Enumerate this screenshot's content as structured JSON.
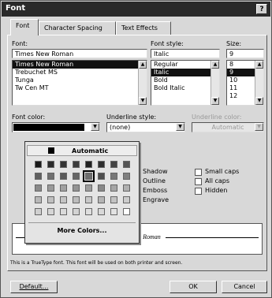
{
  "window": {
    "title": "Font",
    "help": "?"
  },
  "tabs": [
    {
      "label": "Font"
    },
    {
      "label": "Character Spacing"
    },
    {
      "label": "Text Effects"
    }
  ],
  "font": {
    "label": "Font:",
    "value": "Times New Roman",
    "items": [
      "Times New Roman",
      "Trebuchet MS",
      "Tunga",
      "Tw Cen MT"
    ],
    "selected_index": 0
  },
  "style": {
    "label": "Font style:",
    "value": "Italic",
    "items": [
      "Regular",
      "Italic",
      "Bold",
      "Bold Italic"
    ],
    "selected_index": 1
  },
  "size": {
    "label": "Size:",
    "value": "9",
    "items": [
      "8",
      "9",
      "10",
      "11",
      "12"
    ],
    "selected_index": 1
  },
  "font_color": {
    "label": "Font color:"
  },
  "underline_style": {
    "label": "Underline style:",
    "value": "(none)"
  },
  "underline_color": {
    "label": "Underline color:",
    "value": "Automatic"
  },
  "color_popup": {
    "automatic": "Automatic",
    "more": "More Colors...",
    "rows": [
      [
        "#1a1a1a",
        "#2a2a2a",
        "#333333",
        "#3a3a3a",
        "#1f1f1f",
        "#2e2e2e",
        "#444444",
        "#555555"
      ],
      [
        "#606060",
        "#707070",
        "#5a5a5a",
        "#666666",
        "#6e6e6e",
        "#4e4e4e",
        "#777777",
        "#808080"
      ],
      [
        "#8a8a8a",
        "#999999",
        "#a0a0a0",
        "#939393",
        "#9c9c9c",
        "#888888",
        "#a6a6a6",
        "#b0b0b0"
      ],
      [
        "#b8b8b8",
        "#c0c0c0",
        "#c4c4c4",
        "#bcbcbc",
        "#c8c8c8",
        "#b4b4b4",
        "#c2c2c2",
        "#cccccc"
      ],
      [
        "#d0d0d0",
        "#d6d6d6",
        "#dadada",
        "#d3d3d3",
        "#dedede",
        "#d8d8d8",
        "#e2e2e2",
        "#ffffff"
      ]
    ],
    "selected": [
      1,
      4
    ]
  },
  "effects": [
    {
      "label": "Shadow",
      "checked": false
    },
    {
      "label": "Outline",
      "checked": false
    },
    {
      "label": "Emboss",
      "checked": false
    },
    {
      "label": "Engrave",
      "checked": false
    },
    {
      "label": "Small caps",
      "checked": false
    },
    {
      "label": "All caps",
      "checked": false
    },
    {
      "label": "Hidden",
      "checked": false
    }
  ],
  "preview": {
    "text": "Times New Roman"
  },
  "note": "This is a TrueType font. This font will be used on both printer and screen.",
  "buttons": {
    "default": "Default...",
    "ok": "OK",
    "cancel": "Cancel"
  }
}
